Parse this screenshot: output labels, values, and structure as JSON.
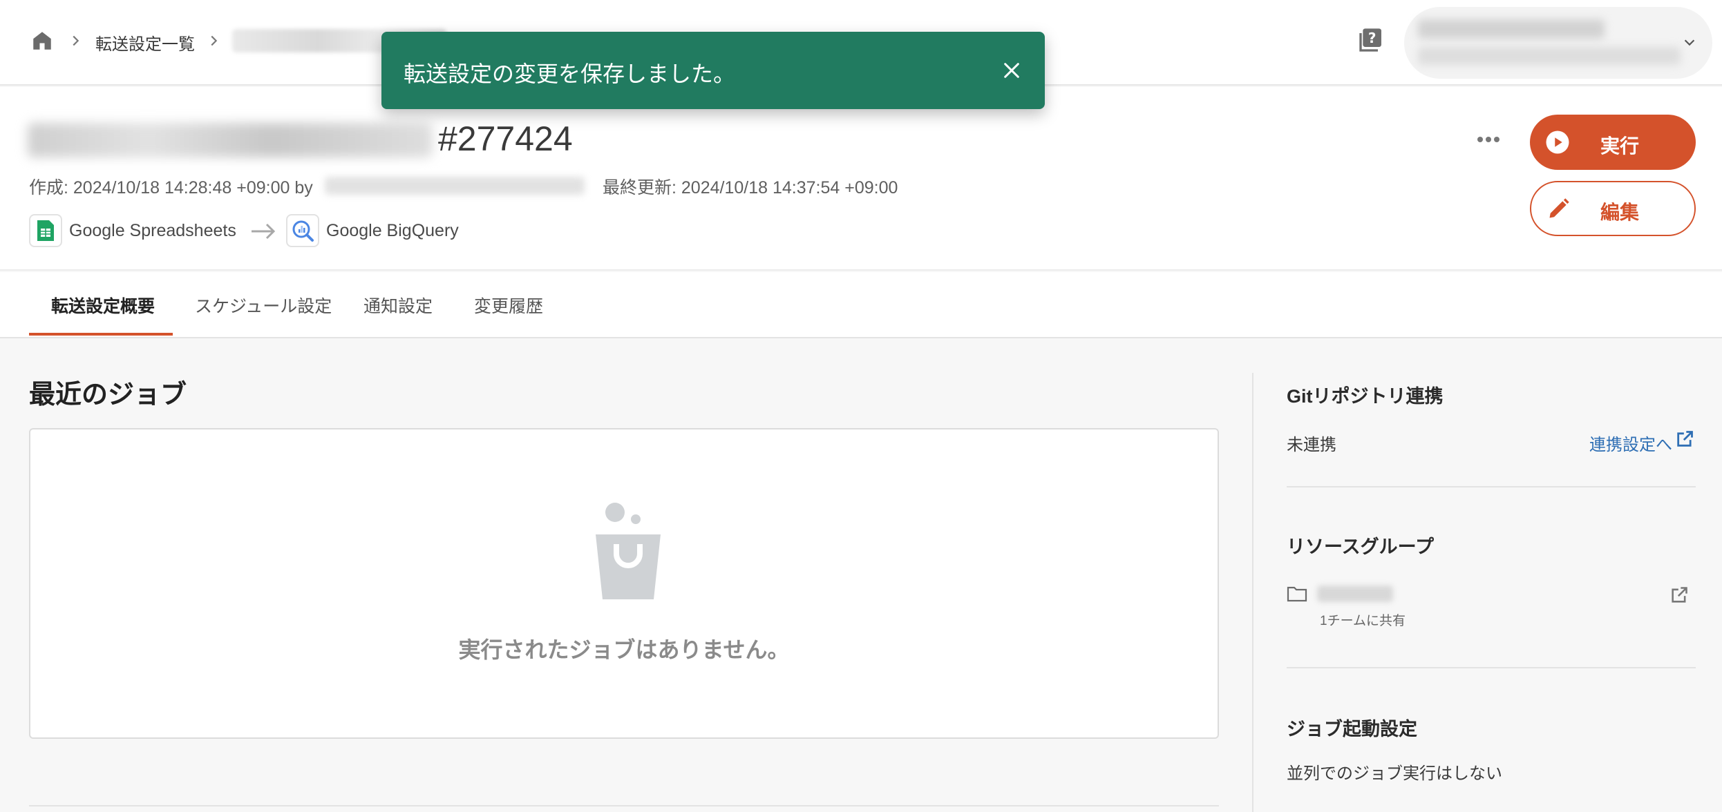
{
  "breadcrumb": {
    "home_icon": "home-icon",
    "list_label": "転送設定一覧"
  },
  "toast": {
    "message": "転送設定の変更を保存しました。",
    "close_icon": "close-icon",
    "color": "#217b60"
  },
  "header": {
    "id": "#277424",
    "created": "作成: 2024/10/18 14:28:48 +09:00 by",
    "updated": "最終更新: 2024/10/18 14:37:54 +09:00",
    "source": "Google Spreadsheets",
    "destination": "Google BigQuery",
    "run_label": "実行",
    "edit_label": "編集",
    "accent_color": "#d4522b"
  },
  "tabs": [
    {
      "label": "転送設定概要",
      "active": true
    },
    {
      "label": "スケジュール設定",
      "active": false
    },
    {
      "label": "通知設定",
      "active": false
    },
    {
      "label": "変更履歴",
      "active": false
    }
  ],
  "main": {
    "recent_jobs_title": "最近のジョブ",
    "empty_message": "実行されたジョブはありません。"
  },
  "side": {
    "git_title": "Gitリポジトリ連携",
    "git_status": "未連携",
    "git_link": "連携設定へ",
    "resource_group_title": "リソースグループ",
    "resource_group_shared": "1チームに共有",
    "job_start_title": "ジョブ起動設定",
    "job_start_value": "並列でのジョブ実行はしない"
  }
}
